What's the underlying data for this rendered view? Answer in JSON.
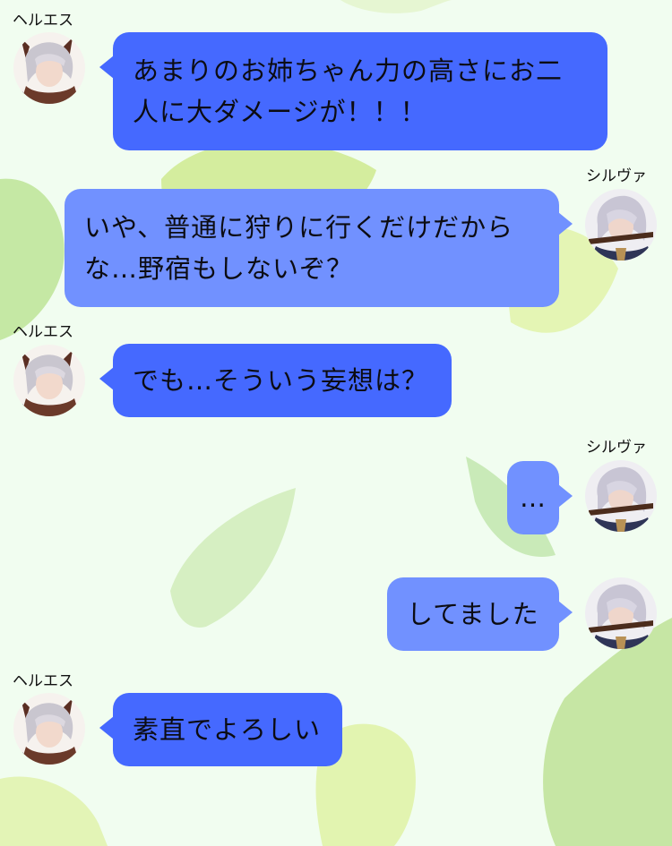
{
  "messages": [
    {
      "sender": "ヘルエス",
      "side": "left",
      "avatar": "helles-avatar",
      "text": "あまりのお姉ちゃん力の高さにお二\n人に大ダメージが！！！"
    },
    {
      "sender": "シルヴァ",
      "side": "right",
      "avatar": "silva-avatar",
      "text": "いや、普通に狩りに行くだけだから\nな…野宿もしないぞ？"
    },
    {
      "sender": "ヘルエス",
      "side": "left",
      "avatar": "helles-avatar",
      "text": "でも…そういう妄想は？"
    },
    {
      "sender": "シルヴァ",
      "side": "right",
      "avatar": "silva-avatar",
      "text": "…"
    },
    {
      "sender": "",
      "side": "right",
      "avatar": "silva-avatar",
      "text": "してました"
    },
    {
      "sender": "ヘルエス",
      "side": "left",
      "avatar": "helles-avatar",
      "text": "素直でよろしい"
    }
  ],
  "colors": {
    "background": "#f1fdf0",
    "left_bubble": "#4569ff",
    "right_bubble": "#7191ff",
    "leaf": "#d8f0a8"
  }
}
